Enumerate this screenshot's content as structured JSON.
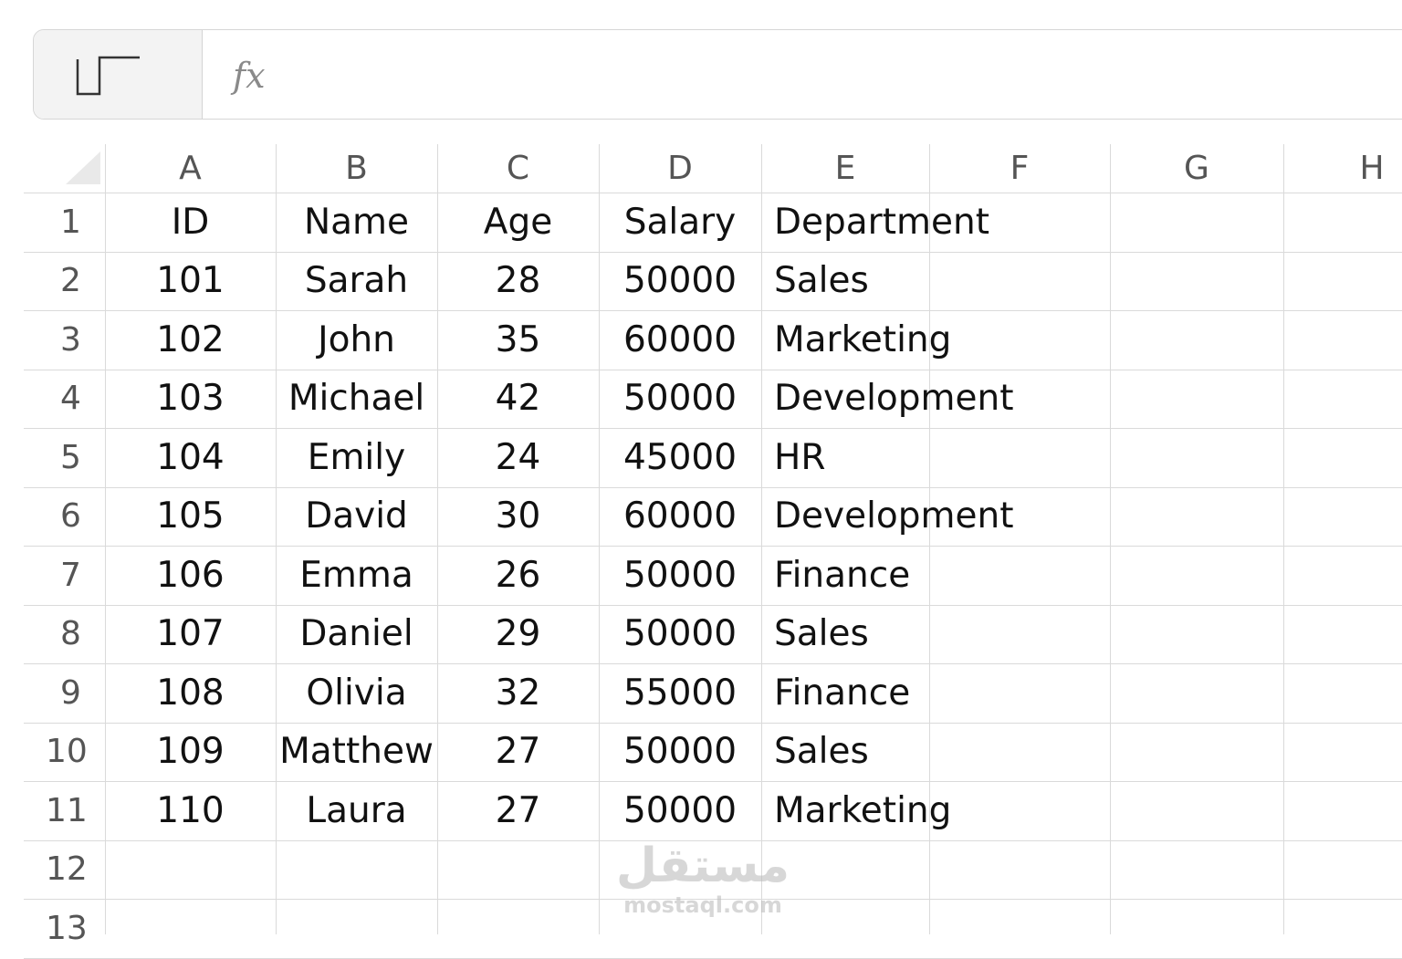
{
  "formula_bar": {
    "name_box_icon": "cell-reference-icon",
    "fx_label": "fx",
    "formula_value": ""
  },
  "columns": [
    "A",
    "B",
    "C",
    "D",
    "E",
    "F",
    "G",
    "H"
  ],
  "rows": [
    "1",
    "2",
    "3",
    "4",
    "5",
    "6",
    "7",
    "8",
    "9",
    "10",
    "11",
    "12",
    "13"
  ],
  "table": {
    "headers": [
      "ID",
      "Name",
      "Age",
      "Salary",
      "Department"
    ],
    "records": [
      [
        "101",
        "Sarah",
        "28",
        "50000",
        "Sales"
      ],
      [
        "102",
        "John",
        "35",
        "60000",
        "Marketing"
      ],
      [
        "103",
        "Michael",
        "42",
        "50000",
        "Development"
      ],
      [
        "104",
        "Emily",
        "24",
        "45000",
        "HR"
      ],
      [
        "105",
        "David",
        "30",
        "60000",
        "Development"
      ],
      [
        "106",
        "Emma",
        "26",
        "50000",
        "Finance"
      ],
      [
        "107",
        "Daniel",
        "29",
        "50000",
        "Sales"
      ],
      [
        "108",
        "Olivia",
        "32",
        "55000",
        "Finance"
      ],
      [
        "109",
        "Matthew",
        "27",
        "50000",
        "Sales"
      ],
      [
        "110",
        "Laura",
        "27",
        "50000",
        "Marketing"
      ]
    ]
  },
  "watermark": {
    "arabic": "مستقل",
    "latin": "mostaql.com"
  },
  "colors": {
    "grid_line": "#dadada",
    "header_text": "#555555",
    "cell_text": "#111111",
    "name_box_bg": "#f3f3f3"
  }
}
